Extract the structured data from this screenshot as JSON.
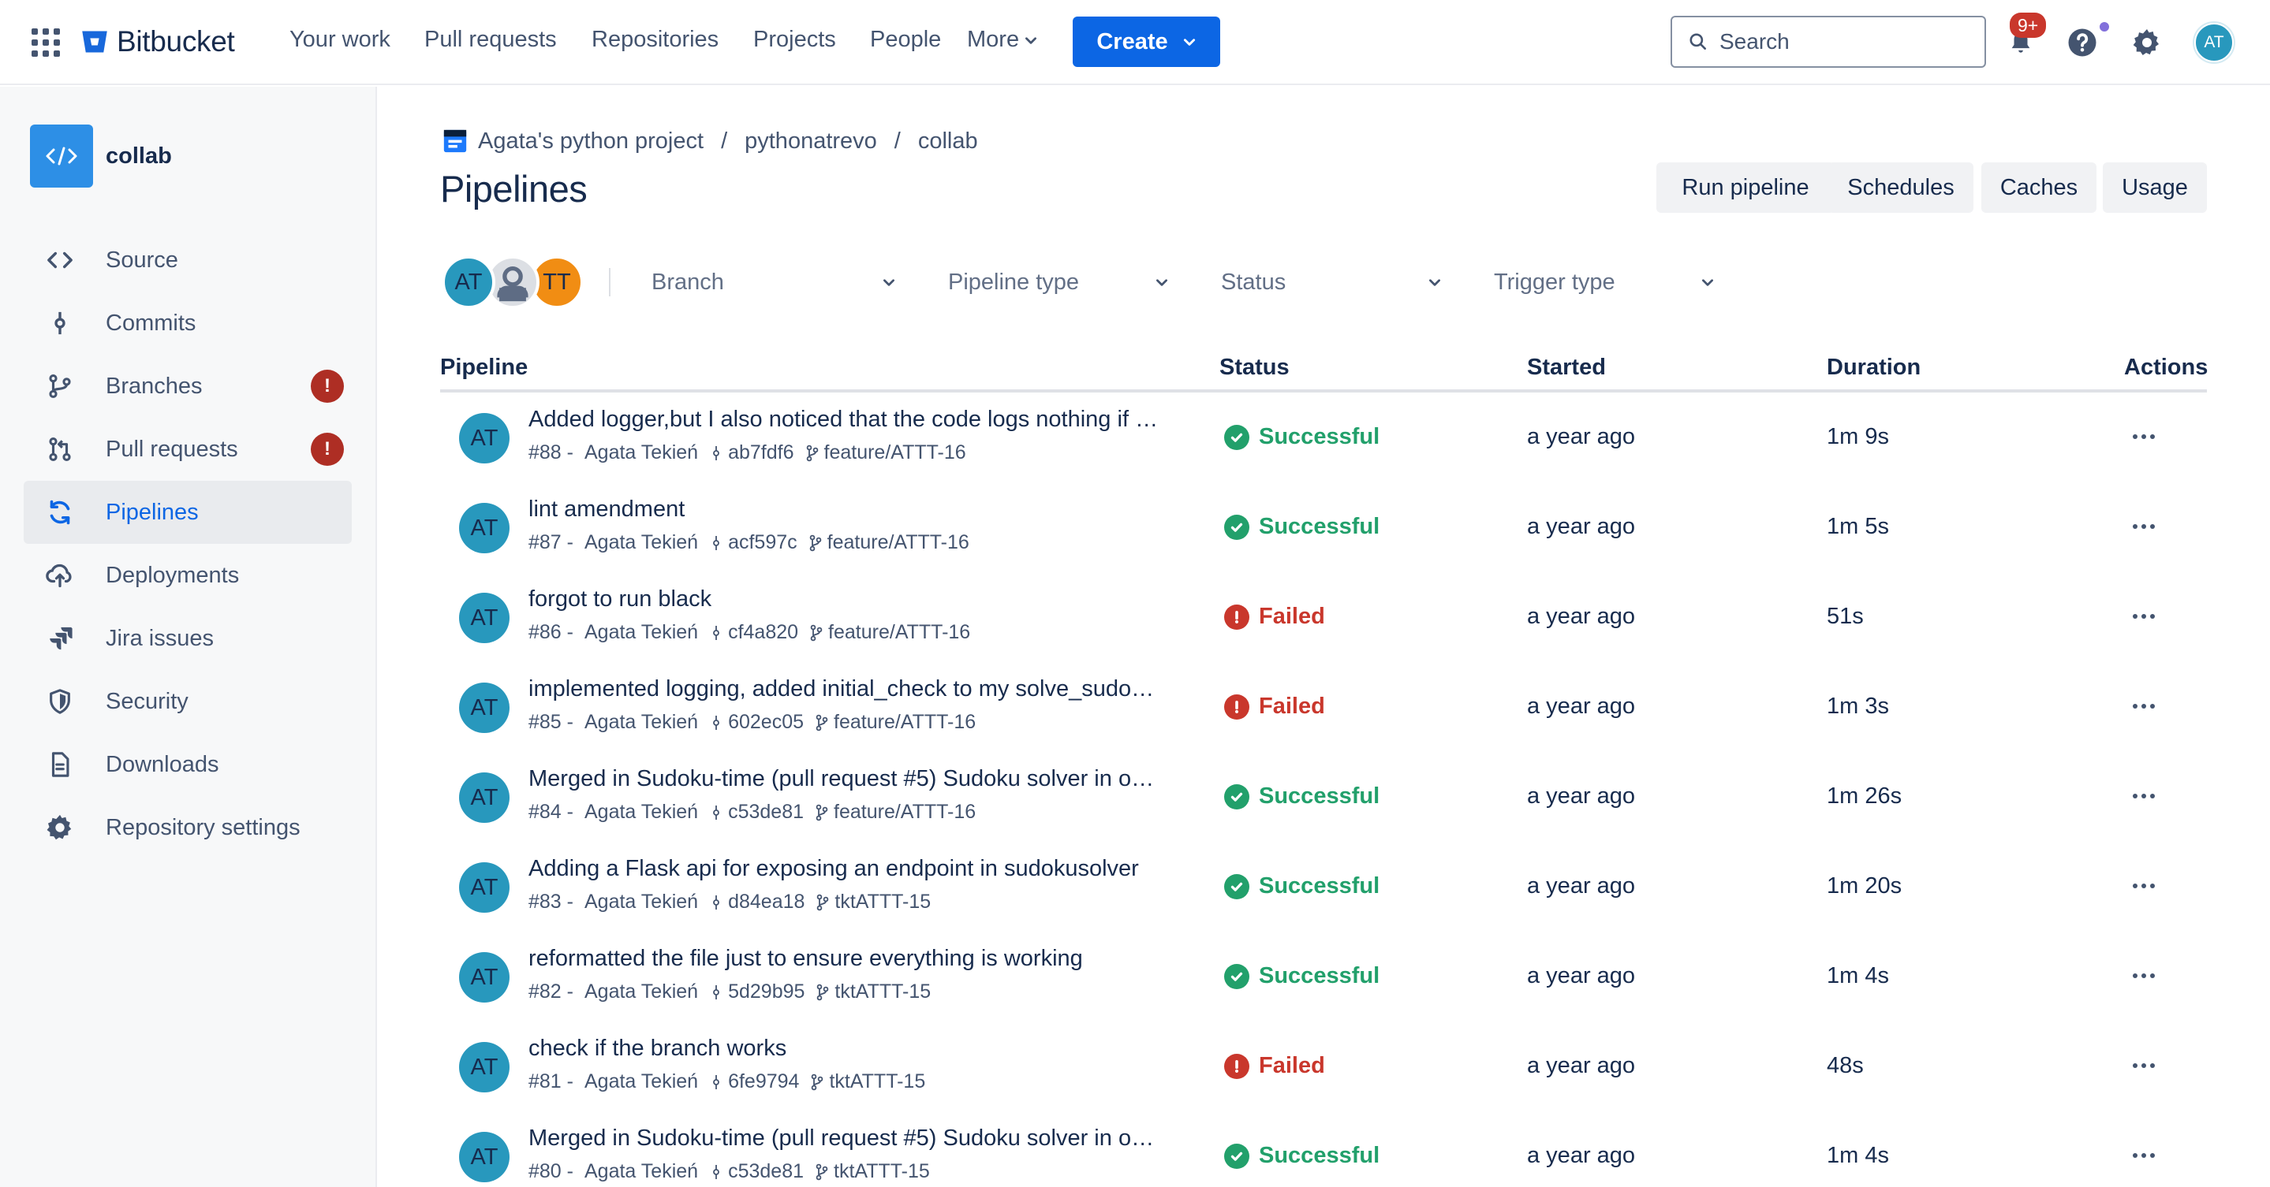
{
  "topnav": {
    "brand": "Bitbucket",
    "items": [
      "Your work",
      "Pull requests",
      "Repositories",
      "Projects",
      "People"
    ],
    "more_label": "More",
    "create_label": "Create",
    "search_placeholder": "Search",
    "notifications_badge": "9+",
    "user_initials": "AT"
  },
  "sidebar": {
    "repo_name": "collab",
    "items": [
      {
        "label": "Source",
        "icon": "code-icon"
      },
      {
        "label": "Commits",
        "icon": "commit-icon"
      },
      {
        "label": "Branches",
        "icon": "branch-icon",
        "badge": "!"
      },
      {
        "label": "Pull requests",
        "icon": "pull-request-icon",
        "badge": "!"
      },
      {
        "label": "Pipelines",
        "icon": "pipelines-icon",
        "active": true
      },
      {
        "label": "Deployments",
        "icon": "deployments-icon"
      },
      {
        "label": "Jira issues",
        "icon": "jira-icon"
      },
      {
        "label": "Security",
        "icon": "shield-icon"
      },
      {
        "label": "Downloads",
        "icon": "file-icon"
      },
      {
        "label": "Repository settings",
        "icon": "gear-icon"
      }
    ]
  },
  "breadcrumb": [
    "Agata's python project",
    "pythonatrevo",
    "collab"
  ],
  "page": {
    "title": "Pipelines",
    "actions": [
      "Run pipeline",
      "Schedules",
      "Caches",
      "Usage"
    ]
  },
  "filters": {
    "avatars": [
      "AT",
      "",
      "TT"
    ],
    "dropdowns": [
      "Branch",
      "Pipeline type",
      "Status",
      "Trigger type"
    ]
  },
  "table": {
    "headers": [
      "Pipeline",
      "Status",
      "Started",
      "Duration",
      "Actions"
    ],
    "rows": [
      {
        "avatar": "AT",
        "title": "Added logger,but I also noticed that the code logs nothing if t...",
        "number": "#88 -",
        "author": "Agata Tekień",
        "commit": "ab7fdf6",
        "branch": "feature/ATTT-16",
        "status": "Successful",
        "started": "a year ago",
        "duration": "1m 9s"
      },
      {
        "avatar": "AT",
        "title": "lint amendment",
        "number": "#87 -",
        "author": "Agata Tekień",
        "commit": "acf597c",
        "branch": "feature/ATTT-16",
        "status": "Successful",
        "started": "a year ago",
        "duration": "1m 5s"
      },
      {
        "avatar": "AT",
        "title": "forgot to run black",
        "number": "#86 -",
        "author": "Agata Tekień",
        "commit": "cf4a820",
        "branch": "feature/ATTT-16",
        "status": "Failed",
        "started": "a year ago",
        "duration": "51s"
      },
      {
        "avatar": "AT",
        "title": "implemented logging, added initial_check to my solve_sudok...",
        "number": "#85 -",
        "author": "Agata Tekień",
        "commit": "602ec05",
        "branch": "feature/ATTT-16",
        "status": "Failed",
        "started": "a year ago",
        "duration": "1m 3s"
      },
      {
        "avatar": "AT",
        "title": "Merged in Sudoku-time (pull request #5) Sudoku solver in oo...",
        "number": "#84 -",
        "author": "Agata Tekień",
        "commit": "c53de81",
        "branch": "feature/ATTT-16",
        "status": "Successful",
        "started": "a year ago",
        "duration": "1m 26s"
      },
      {
        "avatar": "AT",
        "title": "Adding a Flask api for exposing an endpoint in sudokusolver",
        "number": "#83 -",
        "author": "Agata Tekień",
        "commit": "d84ea18",
        "branch": "tktATTT-15",
        "status": "Successful",
        "started": "a year ago",
        "duration": "1m 20s"
      },
      {
        "avatar": "AT",
        "title": "reformatted the file just to ensure everything is working",
        "number": "#82 -",
        "author": "Agata Tekień",
        "commit": "5d29b95",
        "branch": "tktATTT-15",
        "status": "Successful",
        "started": "a year ago",
        "duration": "1m 4s"
      },
      {
        "avatar": "AT",
        "title": "check if the branch works",
        "number": "#81 -",
        "author": "Agata Tekień",
        "commit": "6fe9794",
        "branch": "tktATTT-15",
        "status": "Failed",
        "started": "a year ago",
        "duration": "48s"
      },
      {
        "avatar": "AT",
        "title": "Merged in Sudoku-time (pull request #5) Sudoku solver in oo...",
        "number": "#80 -",
        "author": "Agata Tekień",
        "commit": "c53de81",
        "branch": "tktATTT-15",
        "status": "Successful",
        "started": "a year ago",
        "duration": "1m 4s"
      }
    ]
  },
  "colors": {
    "brand": "#0c66e4",
    "success": "#22a06b",
    "failure": "#c9372c",
    "avatar": "#2898bd",
    "avatar_tt": "#f18d13"
  }
}
